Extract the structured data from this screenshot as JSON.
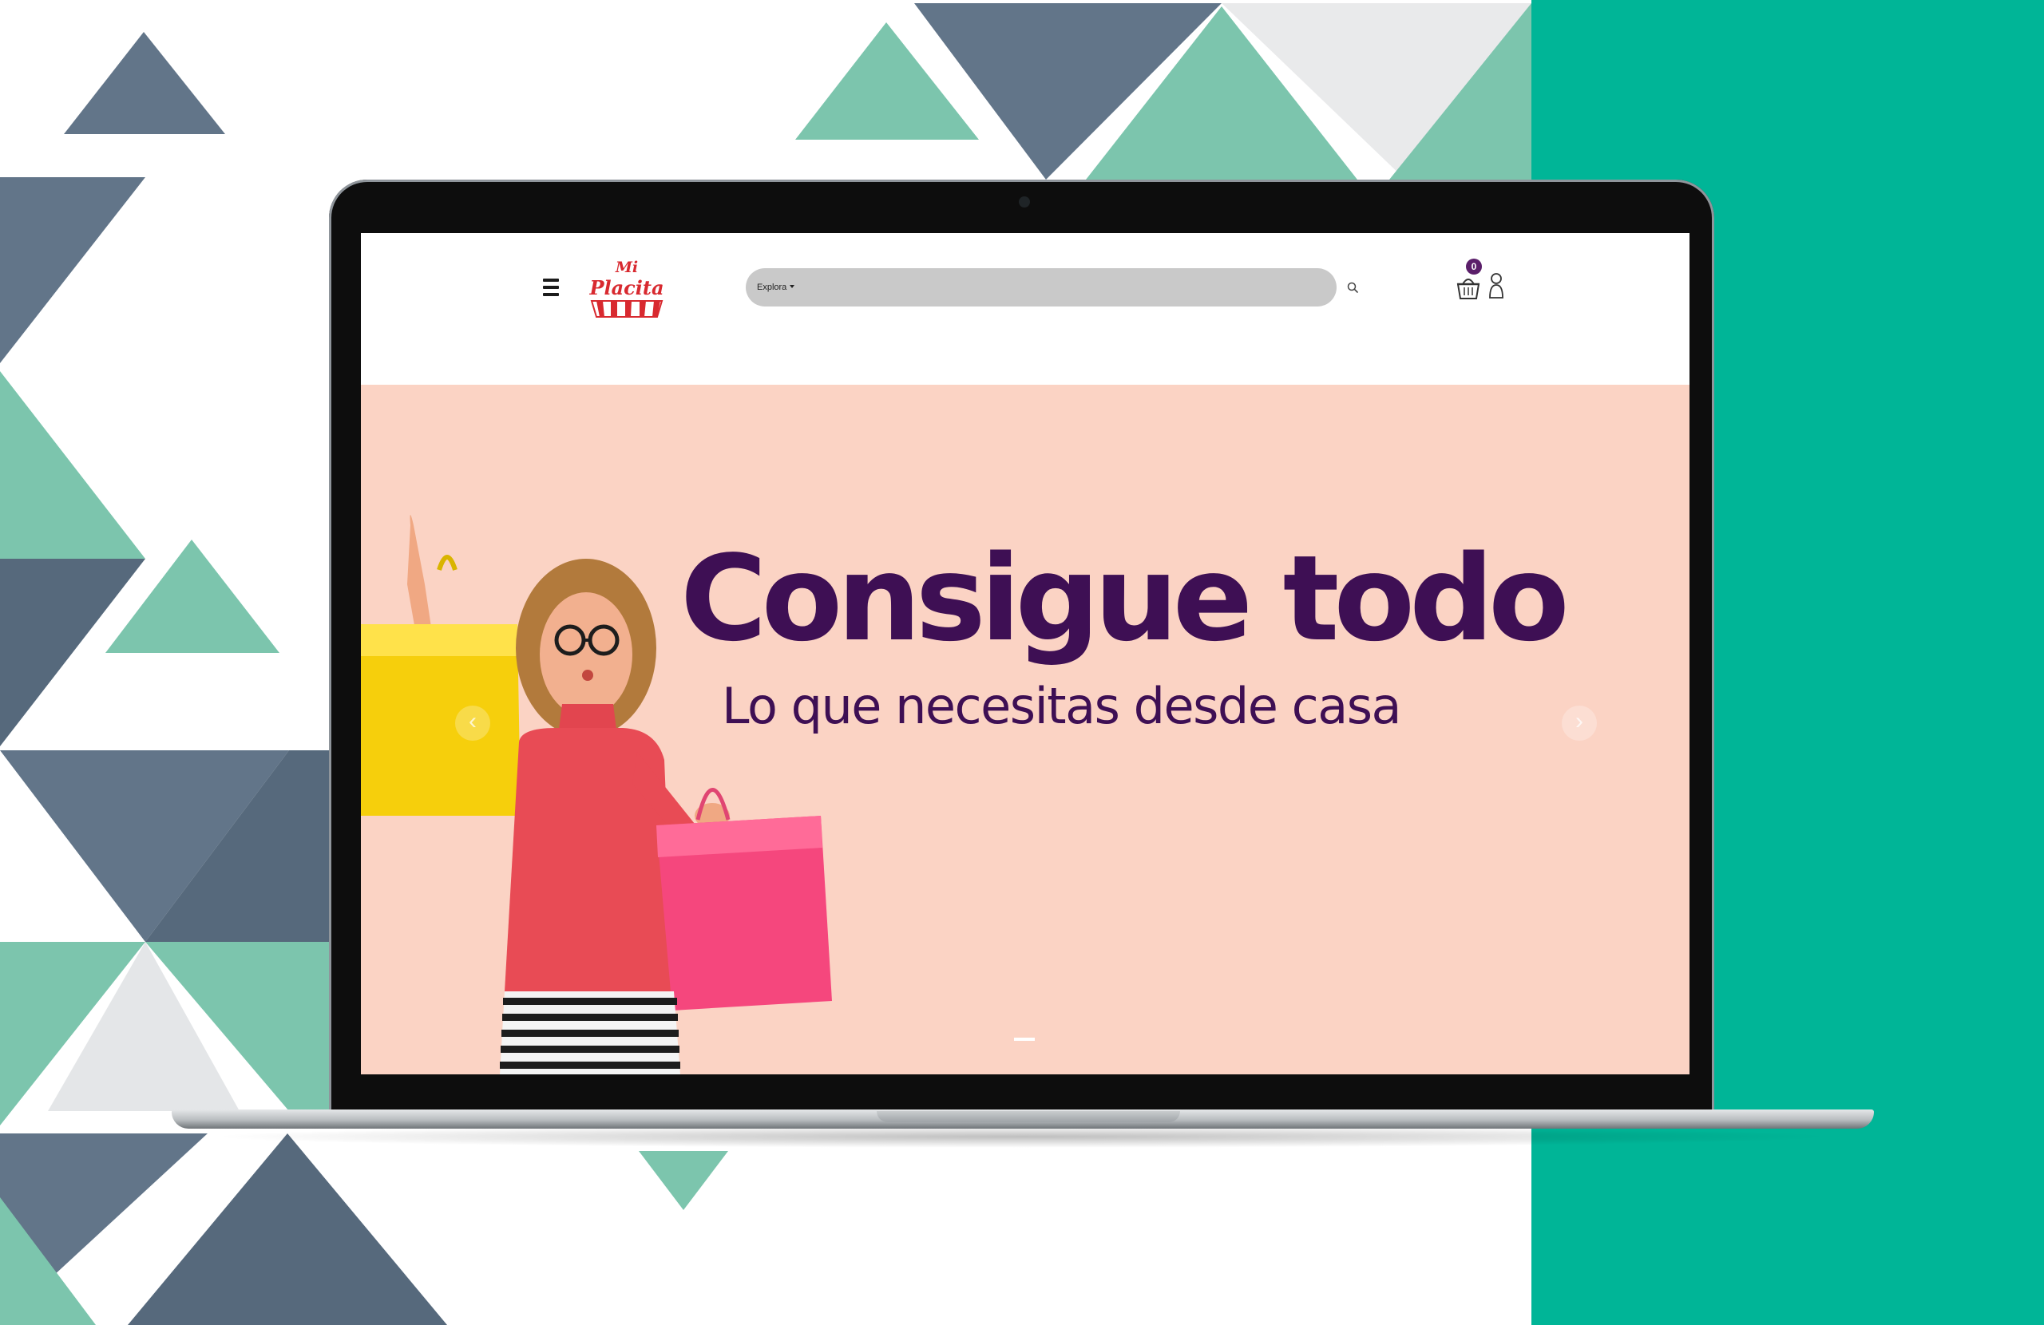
{
  "brand": {
    "logo_line1": "Mi",
    "logo_line2": "Placita"
  },
  "header": {
    "menu_icon": "hamburger-icon",
    "search": {
      "category_label": "Explora",
      "placeholder": ""
    },
    "search_icon": "search-icon",
    "cart_icon": "shopping-basket-icon",
    "cart_count": "0",
    "user_icon": "user-icon"
  },
  "hero": {
    "title": "Consigue todo",
    "subtitle": "Lo que necesitas desde casa",
    "prev_label": "‹",
    "next_label": "›"
  },
  "colors": {
    "accent_purple": "#3e0f54",
    "badge_purple": "#5b1f6a",
    "hero_background": "#fbd3c4",
    "brand_green": "#00b597",
    "slate": "#627589",
    "mint": "#7cc5ad",
    "logo_red": "#d8292f"
  }
}
